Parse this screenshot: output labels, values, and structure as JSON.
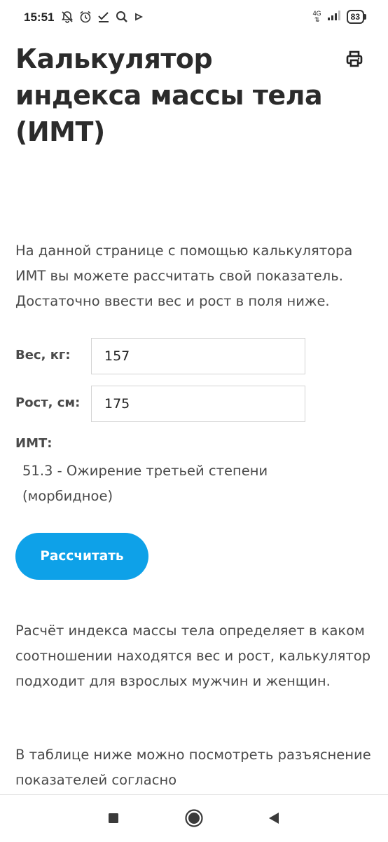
{
  "status_bar": {
    "time": "15:51",
    "network": "4G",
    "battery": "83",
    "icons": [
      "muted-bell-icon",
      "alarm-icon",
      "check-icon",
      "search-icon",
      "play-icon"
    ]
  },
  "header": {
    "title": "Калькулятор индекса массы тела (ИМТ)",
    "print_icon": "print-icon"
  },
  "intro": "На данной странице с помощью калькулятора ИМТ вы можете рассчитать свой показатель. Достаточно ввести вес и рост в поля ниже.",
  "form": {
    "weight_label": "Вес, кг:",
    "weight_value": "157",
    "height_label": "Рост, см:",
    "height_value": "175"
  },
  "result": {
    "label": "ИМТ:",
    "value": "51.3 - Ожирение третьей степени (морбидное)"
  },
  "calculate_button": "Рассчитать",
  "paragraphs": [
    "Расчёт индекса массы тела определяет в каком соотношении находятся вес и рост, калькулятор подходит для взрослых мужчин и женщин.",
    "В таблице ниже можно посмотреть разъяснение показателей согласно"
  ],
  "nav": {
    "recents_icon": "square-icon",
    "home_icon": "circle-icon",
    "back_icon": "triangle-back-icon"
  },
  "colors": {
    "accent": "#0ea1e8",
    "text": "#4a4a4a",
    "title": "#2b2b2b"
  }
}
